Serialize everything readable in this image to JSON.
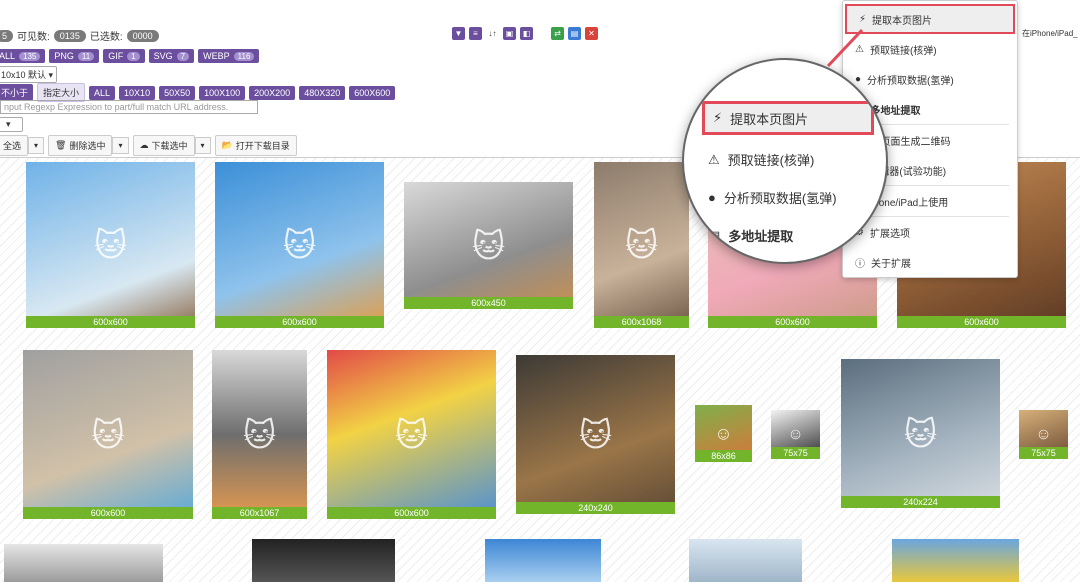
{
  "stats": {
    "count_a": "5",
    "visible_label": "可见数:",
    "visible_value": "0135",
    "selected_label": "已选数:",
    "selected_value": "0000"
  },
  "filters": [
    {
      "label": "ALL",
      "count": "135"
    },
    {
      "label": "PNG",
      "count": "11"
    },
    {
      "label": "GIF",
      "count": "1"
    },
    {
      "label": "SVG",
      "count": "7"
    },
    {
      "label": "WEBP",
      "count": "116"
    }
  ],
  "grid_select": {
    "value": "10x10 默认"
  },
  "size_options": [
    "不小于",
    "指定大小",
    "ALL",
    "10X10",
    "50X50",
    "100X100",
    "200X200",
    "480X320",
    "600X600"
  ],
  "regex": {
    "placeholder": "nput Regexp Expression to part/full match URL address."
  },
  "actions": {
    "select_all": "全选",
    "delete_selected": "删除选中",
    "download_selected": "下载选中",
    "open_folder": "打开下载目录"
  },
  "side_info": "在iPhone/iPad_",
  "colors": {
    "accent_purple": "#6b4f9e",
    "caption_green": "#72b52b",
    "highlight_red": "#e24a5a"
  },
  "menu": {
    "items": [
      {
        "icon": "lightning-icon",
        "label": "提取本页图片"
      },
      {
        "icon": "warning-icon",
        "label": "预取链接(核弹)"
      },
      {
        "icon": "bomb-icon",
        "label": "分析预取数据(氢弹)"
      },
      {
        "icon": "list-icon",
        "label": "多地址提取"
      },
      {
        "icon": "qrcode-icon",
        "label": "前页面生成二维码"
      },
      {
        "icon": "edit-icon",
        "label": "编辑器(试验功能)"
      },
      {
        "icon": "phone-icon",
        "label": "Phone/iPad上使用"
      },
      {
        "icon": "gear-icon",
        "label": "扩展选项"
      },
      {
        "icon": "info-icon",
        "label": "关于扩展"
      }
    ]
  },
  "magnifier": {
    "items": [
      {
        "label": "提取本页图片"
      },
      {
        "label": "预取链接(核弹)"
      },
      {
        "label": "分析预取数据(氢弹)"
      },
      {
        "label": "多地址提取"
      }
    ]
  },
  "images": [
    {
      "caption": "600x600"
    },
    {
      "caption": "600x600"
    },
    {
      "caption": "600x450"
    },
    {
      "caption": "600x1068"
    },
    {
      "caption": "600x600"
    },
    {
      "caption": "600x600"
    },
    {
      "caption": "600x600"
    },
    {
      "caption": "600x1067"
    },
    {
      "caption": "600x600"
    },
    {
      "caption": "240x240"
    },
    {
      "caption": "86x86"
    },
    {
      "caption": "75x75"
    },
    {
      "caption": "240x224"
    },
    {
      "caption": "75x75"
    },
    {
      "caption": ""
    },
    {
      "caption": ""
    },
    {
      "caption": ""
    },
    {
      "caption": ""
    },
    {
      "caption": ""
    }
  ]
}
